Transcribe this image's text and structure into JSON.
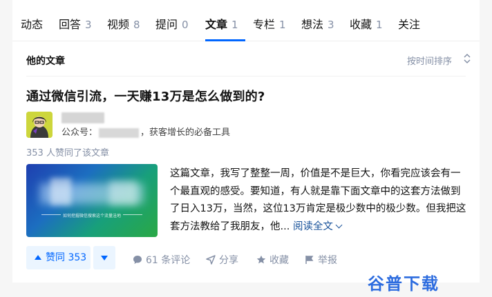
{
  "tabs": [
    {
      "label": "动态",
      "count": ""
    },
    {
      "label": "回答",
      "count": "3"
    },
    {
      "label": "视频",
      "count": "8"
    },
    {
      "label": "提问",
      "count": "0"
    },
    {
      "label": "文章",
      "count": "1"
    },
    {
      "label": "专栏",
      "count": "1"
    },
    {
      "label": "想法",
      "count": "3"
    },
    {
      "label": "收藏",
      "count": "1"
    },
    {
      "label": "关注",
      "count": ""
    }
  ],
  "section": {
    "title": "他的文章",
    "sort_label": "按时间排序"
  },
  "article": {
    "title": "通过微信引流，一天赚13万是怎么做到的?",
    "author": {
      "meta_prefix": "公众号：",
      "meta_suffix": "，获客增长的必备工具"
    },
    "upvote_summary": "353 人赞同了该文章",
    "cover_caption": "如何挖掘微信搜索这个流量洼地",
    "excerpt": "这篇文章，我写了整整一周，价值是不是巨大，你看完应该会有一个最直观的感受。要知道，有人就是靠下面文章中的这套方法做到了日入13万，当然，这位13万肯定是极少数中的极少数。但我把这套方法教给了我朋友，他...",
    "read_more": "阅读全文"
  },
  "actions": {
    "vote_label": "赞同 353",
    "comments": "61 条评论",
    "share": "分享",
    "favorite": "收藏",
    "report": "举报"
  },
  "watermark": "谷普下载",
  "colors": {
    "accent": "#0066ff",
    "muted": "#8590a6",
    "link": "#175199"
  }
}
